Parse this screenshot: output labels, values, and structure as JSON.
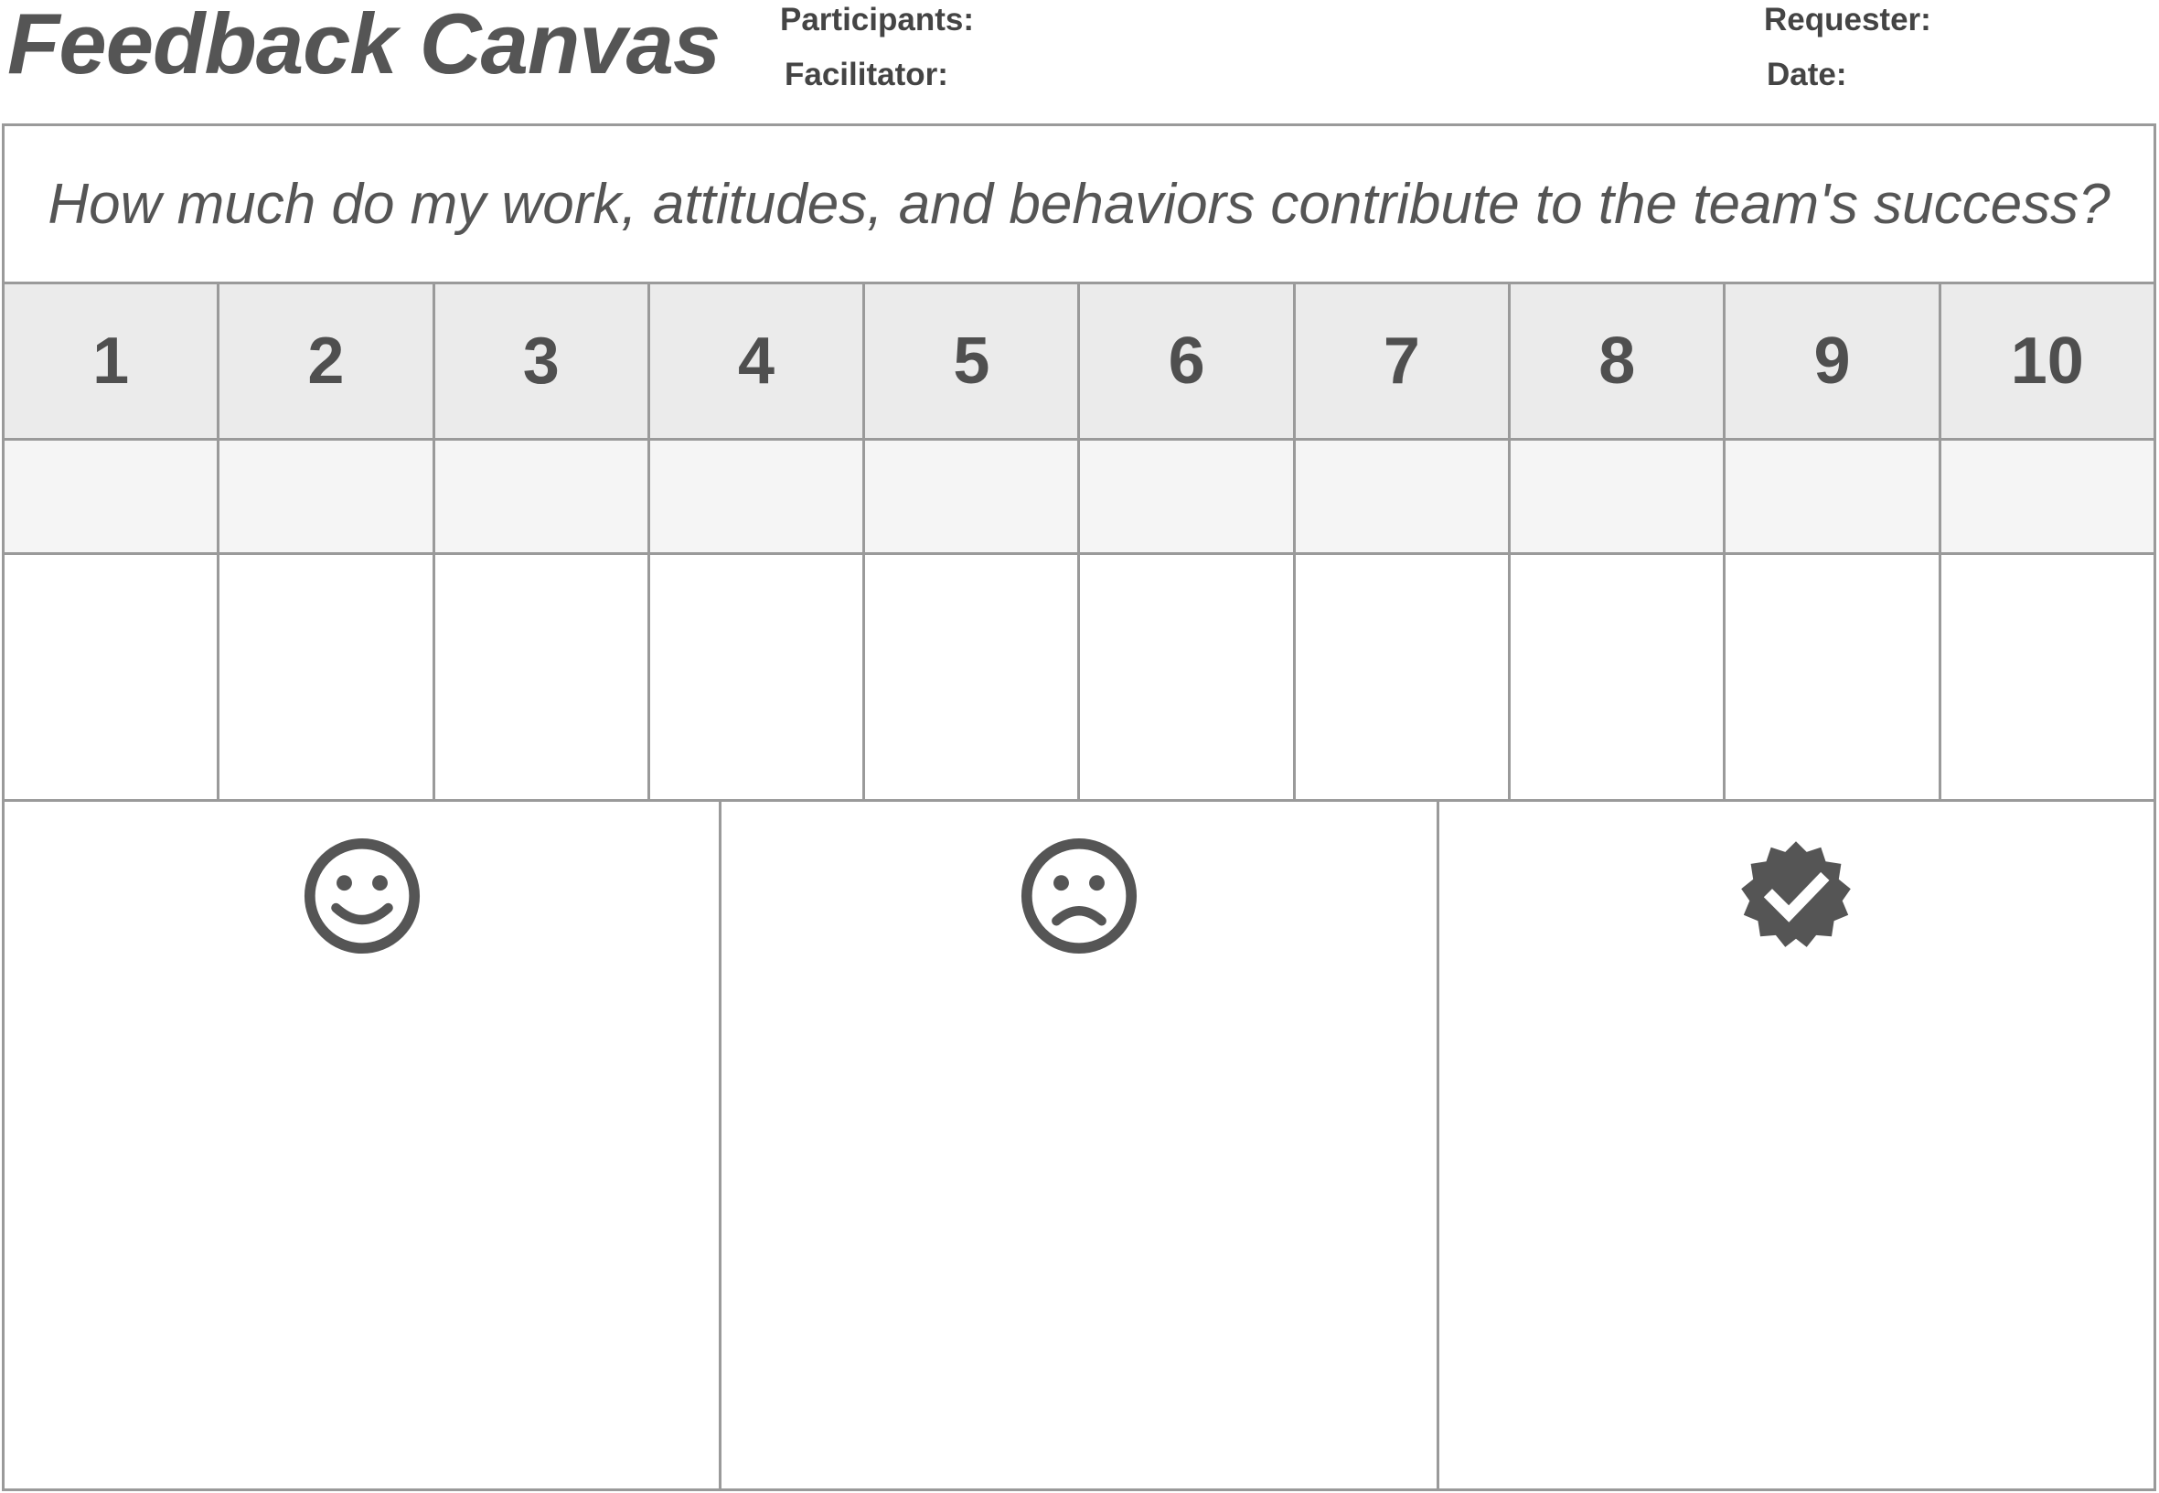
{
  "header": {
    "title": "Feedback Canvas",
    "participants_label": "Participants:",
    "facilitator_label": "Facilitator:",
    "requester_label": "Requester:",
    "date_label": "Date:"
  },
  "question": "How much do my work, attitudes, and behaviors contribute to the team's success?",
  "scale": [
    "1",
    "2",
    "3",
    "4",
    "5",
    "6",
    "7",
    "8",
    "9",
    "10"
  ],
  "feedback_columns": [
    {
      "icon": "smiley-face-icon"
    },
    {
      "icon": "frowning-face-icon"
    },
    {
      "icon": "verified-check-badge-icon"
    }
  ],
  "colors": {
    "text": "#555555",
    "border": "#9a9a9a",
    "header_row_bg": "#ebebeb",
    "tint_row_bg": "#f5f5f5"
  }
}
